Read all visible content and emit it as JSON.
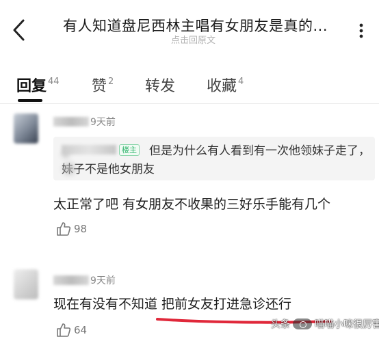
{
  "header": {
    "back_icon": "chevron-left-icon",
    "title": "有人知道盘尼西林主唱有女朋友是真的...",
    "subtitle": "点击回原文",
    "more_icon": "more-dots-icon"
  },
  "tabs": [
    {
      "label": "回复",
      "count": "44",
      "active": true
    },
    {
      "label": "赞",
      "count": "2",
      "active": false
    },
    {
      "label": "转发",
      "count": "",
      "active": false
    },
    {
      "label": "收藏",
      "count": "4",
      "active": false
    }
  ],
  "comments": [
    {
      "time": "9天前",
      "quote": {
        "badge": "楼主",
        "text": "但是为什么有人看到有一次他领妹子走了，妹子不是他女朋友"
      },
      "text": "太正常了吧 有女朋友不收果的三好乐手能有几个",
      "likes": "98"
    },
    {
      "time": "9天前",
      "text": "现在有没有不知道 把前女友打进急诊还行",
      "likes": "64"
    }
  ],
  "watermark": {
    "left": "头条",
    "right": "喵喵小咪很厉害"
  },
  "colors": {
    "badge_green": "#2fb36b",
    "underline_red": "#e0283a",
    "text_primary": "#1e1e1e",
    "text_secondary": "#888888"
  }
}
